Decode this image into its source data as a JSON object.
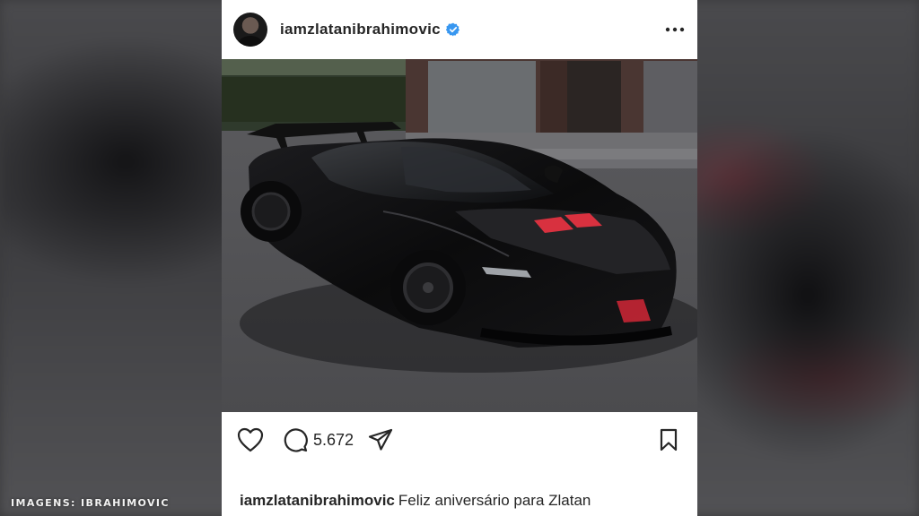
{
  "post": {
    "username": "iamzlatanibrahimovic",
    "verified": true,
    "comment_count": "5.672",
    "caption_user": "iamzlatanibrahimovic",
    "caption_text": "Feliz aniversário para Zlatan"
  },
  "photo": {
    "subject": "black sports car with red vents",
    "accent_color": "#d8313f"
  },
  "overlay": {
    "credit": "IMAGENS: IBRAHIMOVIC"
  },
  "colors": {
    "verified_blue": "#3897f0",
    "text": "#262626"
  },
  "icons": [
    "heart-icon",
    "comment-icon",
    "share-icon",
    "bookmark-icon",
    "more-options-icon",
    "verified-badge-icon"
  ]
}
